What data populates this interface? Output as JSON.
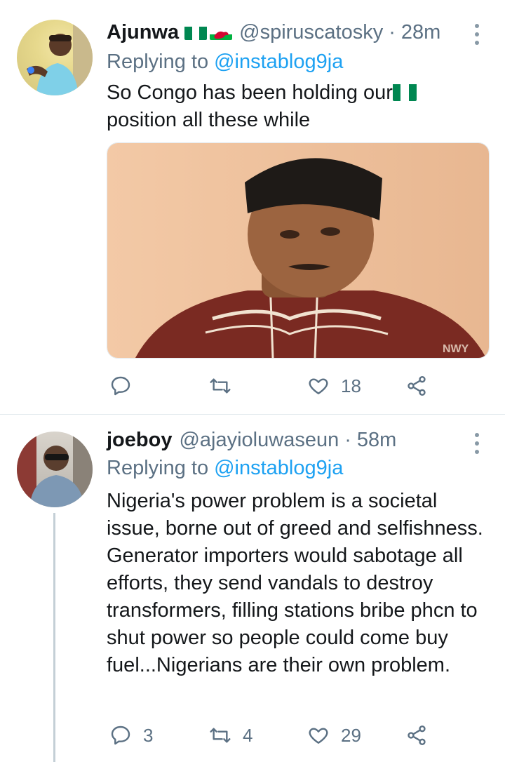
{
  "tweets": [
    {
      "display_name": "Ajunwa",
      "handle": "@spiruscatosky",
      "separator": "·",
      "time": "28m",
      "replying_to_label": "Replying to",
      "replying_to_handle": "@instablog9ja",
      "text": "So Congo has been holding our",
      "text_line2": "position all these while",
      "name_flags": [
        "nigeria-flag-icon",
        "wales-flag-icon"
      ],
      "inline_flag": "nigeria-flag-icon",
      "stats": {
        "replies": "",
        "retweets": "",
        "likes": "18"
      }
    },
    {
      "display_name": "joeboy",
      "handle": "@ajayioluwaseun",
      "separator": "·",
      "time": "58m",
      "replying_to_label": "Replying to",
      "replying_to_handle": "@instablog9ja",
      "text": "Nigeria's power problem is a societal issue, borne out of greed and selfishness. Generator importers would sabotage all efforts, they send vandals to destroy transformers, filling stations bribe phcn to shut power so people could come buy fuel...Nigerians are their own problem.",
      "stats": {
        "replies": "3",
        "retweets": "4",
        "likes": "29"
      }
    }
  ],
  "media": {
    "watermark": "NWY"
  },
  "colors": {
    "link": "#1da1f2",
    "secondary_text": "#5b7083",
    "primary_text": "#14171a",
    "divider": "#e1e8ed",
    "thread_line": "#c4cfd6"
  },
  "icons": [
    "reply-icon",
    "retweet-icon",
    "like-icon",
    "share-icon",
    "more-options-icon"
  ]
}
